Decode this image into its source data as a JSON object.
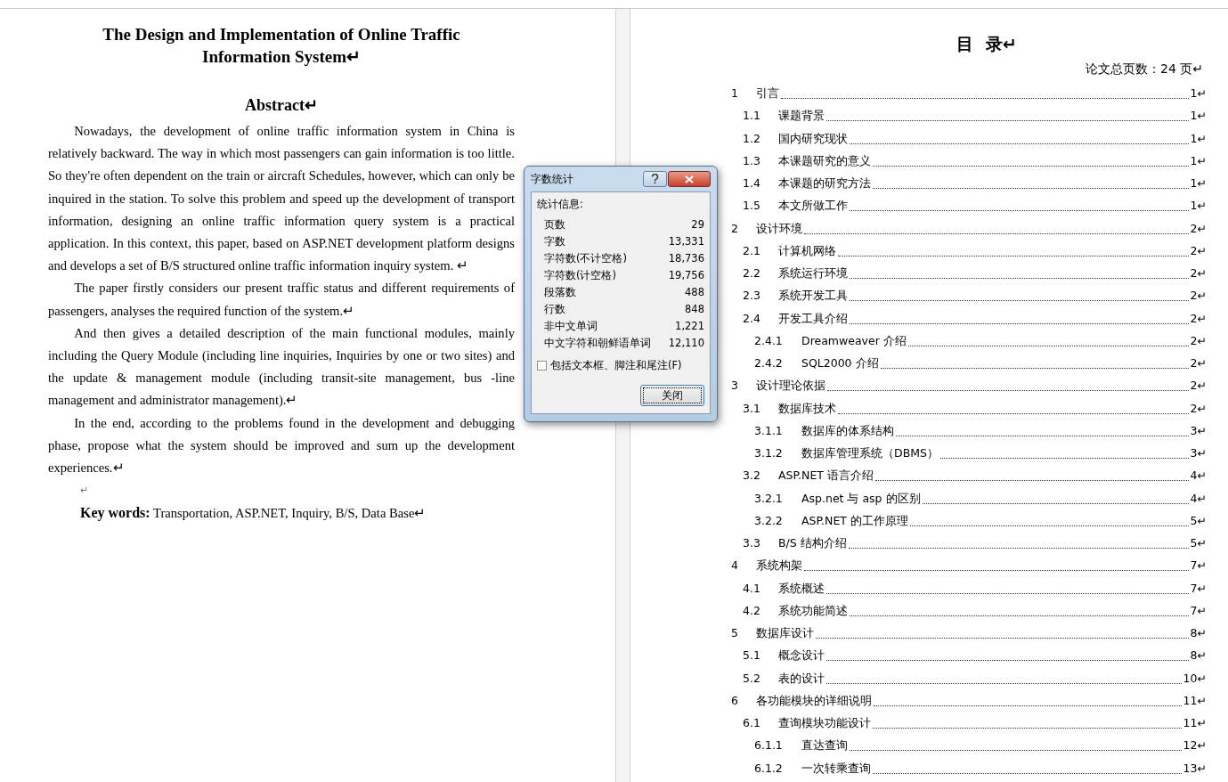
{
  "left_page": {
    "title": "The Design and Implementation of Online Traffic Information System↵",
    "heading": "Abstract↵",
    "paragraphs": [
      "Nowadays, the development of online traffic information system in China is relatively backward. The way in which most passengers can gain information is too little. So they're often dependent on the train or aircraft Schedules, however, which can only be inquired in the station. To solve this problem and speed up the development of transport information, designing an online traffic information query system is a practical application. In this context, this paper, based on ASP.NET development platform designs and develops a set of B/S structured online traffic information inquiry system.  ↵",
      "The paper firstly considers our present traffic status and different requirements of passengers, analyses the required function of the system.↵",
      "And then gives a detailed description of the main functional modules, mainly including the Query Module (including line inquiries, Inquiries by one or two sites) and the update & management module (including transit-site management, bus -line management and administrator management).↵",
      "In the end, according to the problems found in the development and debugging phase, propose what the system should be improved and sum up the development experiences.↵"
    ],
    "blank_mark": "↵",
    "keywords": "**Key words:** Transportation, ASP.NET, Inquiry, B/S, Data Base↵"
  },
  "right_page": {
    "title": "目  录↵",
    "total_pages": "论文总页数：24 页↵",
    "toc": [
      {
        "number": "1",
        "title": "引言",
        "page": "1↵",
        "children": [
          {
            "number": "1.1",
            "title": "课题背景",
            "page": "1↵"
          },
          {
            "number": "1.2",
            "title": "国内研究现状",
            "page": "1↵"
          },
          {
            "number": "1.3",
            "title": "本课题研究的意义",
            "page": "1↵"
          },
          {
            "number": "1.4",
            "title": "本课题的研究方法",
            "page": "1↵"
          },
          {
            "number": "1.5",
            "title": "本文所做工作",
            "page": "1↵"
          }
        ]
      },
      {
        "number": "2",
        "title": "设计环境",
        "page": "2↵",
        "children": [
          {
            "number": "2.1",
            "title": "计算机网络",
            "page": "2↵"
          },
          {
            "number": "2.2",
            "title": "系统运行环境",
            "page": "2↵"
          },
          {
            "number": "2.3",
            "title": "系统开发工具",
            "page": "2↵"
          },
          {
            "number": "2.4",
            "title": "开发工具介绍",
            "page": "2↵",
            "children": [
              {
                "number": "2.4.1",
                "title": "Dreamweaver 介绍",
                "page": "2↵"
              },
              {
                "number": "2.4.2",
                "title": "SQL2000 介绍",
                "page": "2↵"
              }
            ]
          }
        ]
      },
      {
        "number": "3",
        "title": "设计理论依据",
        "page": "2↵",
        "children": [
          {
            "number": "3.1",
            "title": "数据库技术",
            "page": "2↵",
            "children": [
              {
                "number": "3.1.1",
                "title": "数据库的体系结构",
                "page": "3↵"
              },
              {
                "number": "3.1.2",
                "title": "数据库管理系统（DBMS）",
                "page": "3↵"
              }
            ]
          },
          {
            "number": "3.2",
            "title": "ASP.NET 语言介绍",
            "page": "4↵",
            "children": [
              {
                "number": "3.2.1",
                "title": "Asp.net 与 asp 的区别",
                "page": "4↵"
              },
              {
                "number": "3.2.2",
                "title": "ASP.NET 的工作原理",
                "page": "5↵"
              }
            ]
          },
          {
            "number": "3.3",
            "title": "B/S 结构介绍",
            "page": "5↵"
          }
        ]
      },
      {
        "number": "4",
        "title": "系统构架",
        "page": "7↵",
        "children": [
          {
            "number": "4.1",
            "title": "系统概述",
            "page": "7↵"
          },
          {
            "number": "4.2",
            "title": "系统功能简述",
            "page": "7↵"
          }
        ]
      },
      {
        "number": "5",
        "title": "数据库设计",
        "page": "8↵",
        "children": [
          {
            "number": "5.1",
            "title": "概念设计",
            "page": "8↵"
          },
          {
            "number": "5.2",
            "title": "表的设计",
            "page": "10↵"
          }
        ]
      },
      {
        "number": "6",
        "title": "各功能模块的详细说明",
        "page": "11↵",
        "children": [
          {
            "number": "6.1",
            "title": "查询模块功能设计",
            "page": "11↵",
            "children": [
              {
                "number": "6.1.1",
                "title": "直达查询",
                "page": "12↵"
              },
              {
                "number": "6.1.2",
                "title": "一次转乘查询",
                "page": "13↵"
              }
            ]
          }
        ]
      }
    ]
  },
  "dialog": {
    "title": "字数统计",
    "section": "统计信息:",
    "stats": [
      {
        "label": "页数",
        "value": "29"
      },
      {
        "label": "字数",
        "value": "13,331"
      },
      {
        "label": "字符数(不计空格)",
        "value": "18,736"
      },
      {
        "label": "字符数(计空格)",
        "value": "19,756"
      },
      {
        "label": "段落数",
        "value": "488"
      },
      {
        "label": "行数",
        "value": "848"
      },
      {
        "label": "非中文单词",
        "value": "1,221"
      },
      {
        "label": "中文字符和朝鲜语单词",
        "value": "12,110"
      }
    ],
    "checkbox": {
      "label": "包括文本框、脚注和尾注(F)",
      "checked": false
    },
    "button": "关闭"
  }
}
